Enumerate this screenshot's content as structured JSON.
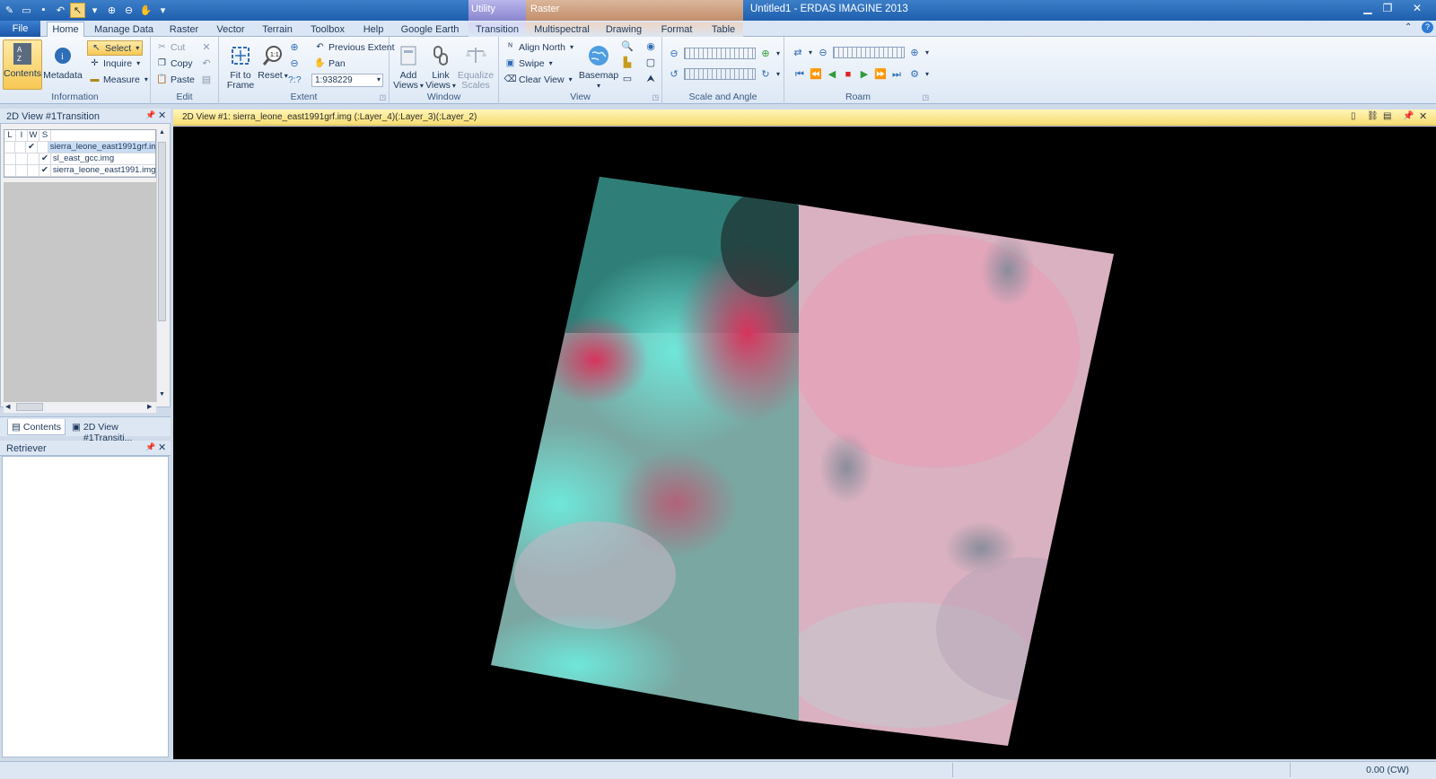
{
  "window": {
    "title": "Untitled1 - ERDAS IMAGINE 2013",
    "context_group_utility": "Utility",
    "context_group_raster": "Raster"
  },
  "tabs": {
    "file": "File",
    "home": "Home",
    "manage_data": "Manage Data",
    "raster": "Raster",
    "vector": "Vector",
    "terrain": "Terrain",
    "toolbox": "Toolbox",
    "help": "Help",
    "google_earth": "Google Earth",
    "transition": "Transition",
    "multispectral": "Multispectral",
    "drawing": "Drawing",
    "format": "Format",
    "table": "Table"
  },
  "ribbon": {
    "information": {
      "label": "Information",
      "contents": "Contents",
      "metadata": "Metadata",
      "select": "Select",
      "inquire": "Inquire",
      "measure": "Measure"
    },
    "edit": {
      "label": "Edit",
      "cut": "Cut",
      "copy": "Copy",
      "paste": "Paste"
    },
    "extent": {
      "label": "Extent",
      "fit_to_frame_1": "Fit to",
      "fit_to_frame_2": "Frame",
      "reset": "Reset",
      "previous_extent": "Previous Extent",
      "pan": "Pan",
      "scale_value": "1:938229",
      "unknown_scale": "?:?"
    },
    "window": {
      "label": "Window",
      "add_views_1": "Add",
      "add_views_2": "Views",
      "link_views_1": "Link",
      "link_views_2": "Views",
      "equalize_1": "Equalize",
      "equalize_2": "Scales"
    },
    "view": {
      "label": "View",
      "align_north": "Align North",
      "swipe": "Swipe",
      "clear_view": "Clear View",
      "basemap": "Basemap"
    },
    "scale_angle": {
      "label": "Scale and Angle"
    },
    "roam": {
      "label": "Roam"
    }
  },
  "contents_panel": {
    "title": "2D View #1Transition",
    "columns": [
      "L",
      "I",
      "W",
      "S"
    ],
    "layers": [
      {
        "name": "sierra_leone_east1991grf.img",
        "checked": true
      },
      {
        "name": "sl_east_gcc.img",
        "checked": true
      },
      {
        "name": "sierra_leone_east1991.img",
        "checked": true
      }
    ],
    "tab_contents": "Contents",
    "tab_view": "2D View #1Transiti..."
  },
  "retriever": {
    "title": "Retriever"
  },
  "view": {
    "header": "2D View #1: sierra_leone_east1991grf.img (:Layer_4)(:Layer_3)(:Layer_2)"
  },
  "status": {
    "rotation": "0.00 (CW)"
  },
  "colors": {
    "accent": "#1f5fae",
    "view_header": "#f7dd72",
    "ribbon_bg": "#dde8f5"
  }
}
